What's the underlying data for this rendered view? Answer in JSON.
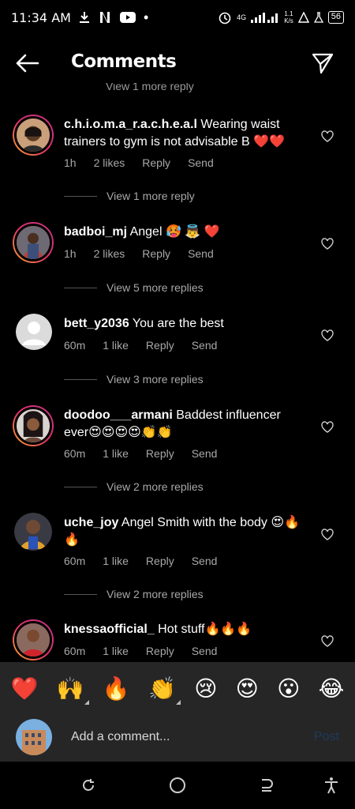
{
  "status_bar": {
    "time": "11:34 AM",
    "network": "4G",
    "speed_top": "1.1",
    "speed_bottom": "K/s",
    "battery": "56"
  },
  "header": {
    "title": "Comments"
  },
  "cut_reply": "View 1 more reply",
  "comments": [
    {
      "username": "c.h.i.o.m.a_r.a.c.h.e.a.l",
      "text": " Wearing waist trainers to gym is not advisable B ❤️❤️",
      "time": "1h",
      "likes": "2 likes",
      "reply": "Reply",
      "send": "Send",
      "replies": "View 1 more reply"
    },
    {
      "username": "badboi_mj",
      "text": " Angel 🥵 👼 ❤️",
      "time": "1h",
      "likes": "2 likes",
      "reply": "Reply",
      "send": "Send",
      "replies": "View 5 more replies"
    },
    {
      "username": "bett_y2036",
      "text": " You are the best",
      "time": "60m",
      "likes": "1 like",
      "reply": "Reply",
      "send": "Send",
      "replies": "View 3 more replies"
    },
    {
      "username": "doodoo___armani",
      "text": " Baddest influencer ever😍😍😍😍👏👏",
      "time": "60m",
      "likes": "1 like",
      "reply": "Reply",
      "send": "Send",
      "replies": "View 2 more replies"
    },
    {
      "username": "uche_joy",
      "text": " Angel Smith with the body 😍🔥🔥",
      "time": "60m",
      "likes": "1 like",
      "reply": "Reply",
      "send": "Send",
      "replies": "View 2 more replies"
    },
    {
      "username": "knessaofficial_",
      "text": " Hot stuff🔥🔥🔥",
      "time": "60m",
      "likes": "1 like",
      "reply": "Reply",
      "send": "Send"
    }
  ],
  "emoji_bar": [
    "❤️",
    "🙌",
    "🔥",
    "👏",
    "😢",
    "😍",
    "😮",
    "😂"
  ],
  "composer": {
    "placeholder": "Add a comment...",
    "post_label": "Post"
  },
  "colors": {
    "accent_disabled": "#1e3a5e",
    "heart_red": "#e0245e",
    "story_ring": "#e1306c"
  }
}
